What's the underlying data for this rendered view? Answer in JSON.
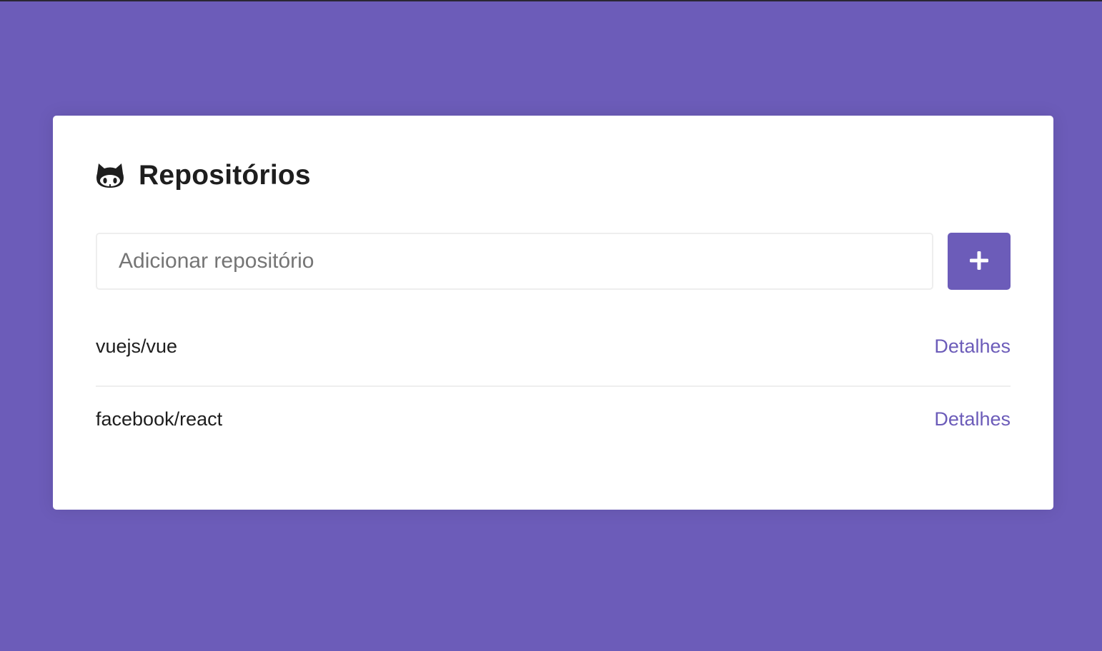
{
  "colors": {
    "background": "#6c5cb9",
    "accent": "#6c5cb9",
    "card": "#ffffff",
    "text": "#1e1e1e"
  },
  "header": {
    "icon": "github-icon",
    "title": "Repositórios"
  },
  "form": {
    "input_value": "",
    "input_placeholder": "Adicionar repositório",
    "add_button_icon": "plus-icon"
  },
  "repositories": [
    {
      "name": "vuejs/vue",
      "link_label": "Detalhes"
    },
    {
      "name": "facebook/react",
      "link_label": "Detalhes"
    }
  ]
}
